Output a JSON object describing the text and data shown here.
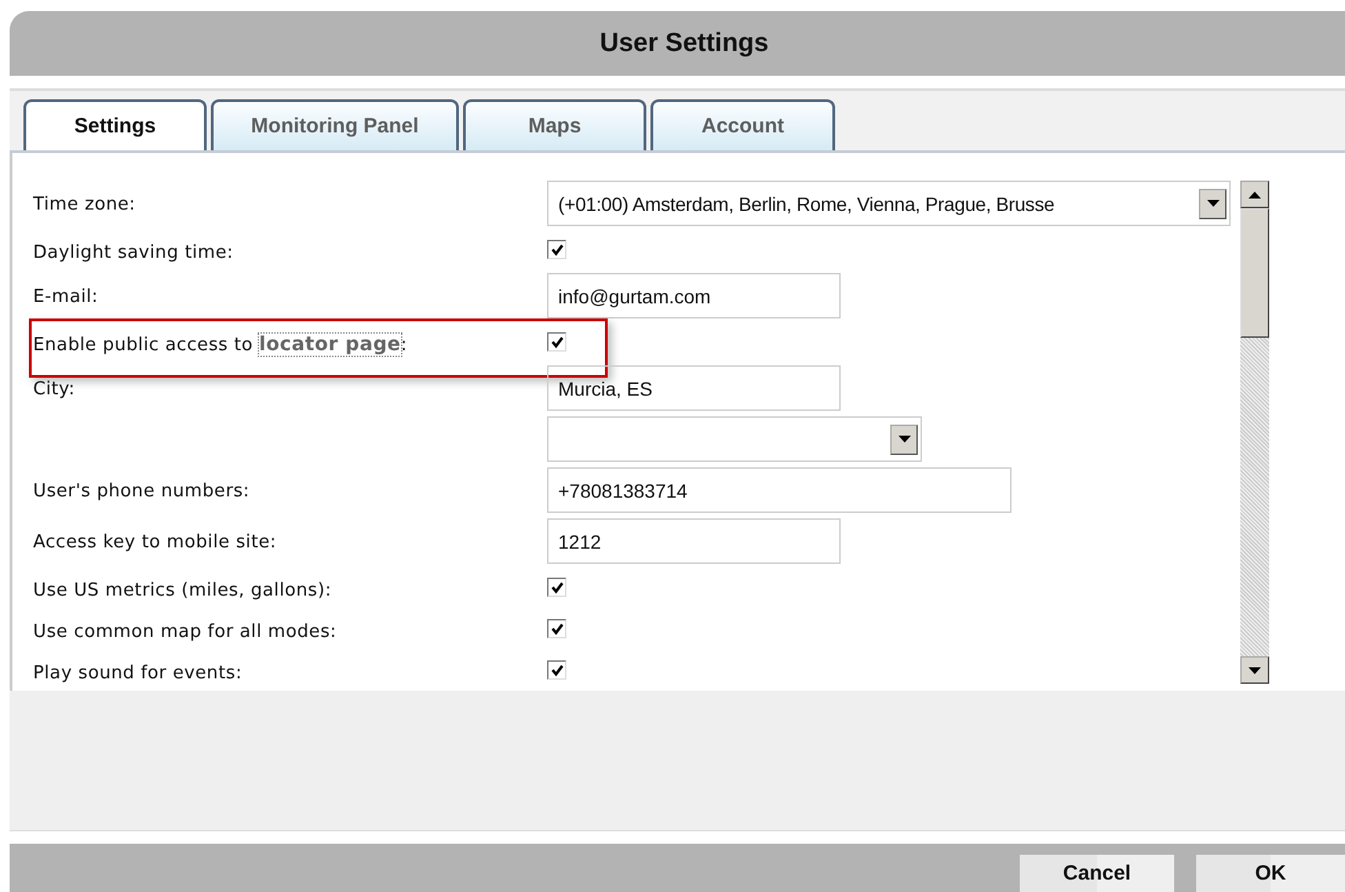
{
  "window": {
    "title": "User Settings"
  },
  "tabs": [
    {
      "label": "Settings",
      "selected": true
    },
    {
      "label": "Monitoring Panel",
      "selected": false
    },
    {
      "label": "Maps",
      "selected": false
    },
    {
      "label": "Account",
      "selected": false
    }
  ],
  "rows": [
    {
      "kind": "select",
      "label": "Time zone:",
      "value": "(+01:00) Amsterdam, Berlin, Rome, Vienna, Prague, Brusse"
    },
    {
      "kind": "checkbox",
      "label": "Daylight saving time:",
      "checked": true
    },
    {
      "kind": "text",
      "label": "E-mail:",
      "value": "info@gurtam.com"
    },
    {
      "kind": "checkbox",
      "label": "Enable public access to",
      "link": "locator page",
      "label_after": ":",
      "checked": true,
      "highlighted": true
    },
    {
      "kind": "text",
      "label": "City:",
      "value": "Murcia, ES"
    },
    {
      "kind": "select"
    },
    {
      "kind": "text",
      "label": "User's phone numbers:",
      "value": "+78081383714"
    },
    {
      "kind": "text",
      "label": "Access key to mobile site:",
      "value": "1212"
    },
    {
      "kind": "checkbox",
      "label": "Use US metrics (miles, gallons):",
      "checked": true
    },
    {
      "kind": "checkbox",
      "label": "Use common map for all modes:",
      "checked": true
    },
    {
      "kind": "checkbox",
      "label": "Play sound for events:",
      "checked": true
    }
  ],
  "buttons": [
    {
      "label": "Cancel"
    },
    {
      "label": "OK"
    }
  ]
}
